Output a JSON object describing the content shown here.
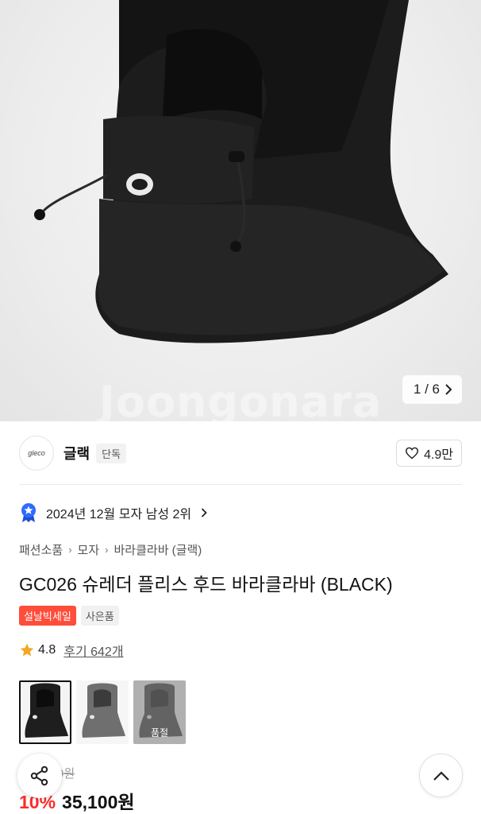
{
  "hero": {
    "watermark": "Joongonara",
    "counter": "1 / 6",
    "counter_icon": "chevron-right-icon"
  },
  "store": {
    "logo_text": "gleco",
    "name": "글랙",
    "badge": "단독",
    "likes": "4.9만",
    "like_icon": "heart-outline-icon"
  },
  "ranking": {
    "text": "2024년 12월 모자 남성 2위",
    "icon": "ranking-medal-icon",
    "icon_color": "#2f6bff"
  },
  "breadcrumb": [
    "패션소품",
    "모자",
    "바라클라바 (글랙)"
  ],
  "product": {
    "title": "GC026 슈레더 플리스 후드 바라클라바 (BLACK)",
    "tags": {
      "sale": "설날빅세일",
      "gift": "사은품"
    },
    "rating": "4.8",
    "reviews": "후기 642개",
    "star_color": "#f5a623"
  },
  "options": {
    "items": [
      {
        "color_name": "black",
        "swatch": "#1e1e1e",
        "selected": true
      },
      {
        "color_name": "gray",
        "swatch": "#6f6f6f",
        "selected": false
      },
      {
        "color_name": "gray",
        "swatch": "#4a4a4a",
        "selected": false,
        "soldout_label": "품절"
      }
    ]
  },
  "price": {
    "original_fragment": "9원",
    "discount": "10%",
    "final": "35,100원",
    "discount_color": "#ff2a2a"
  },
  "floating": {
    "share_icon": "share-icon",
    "top_icon": "chevron-up-icon"
  }
}
